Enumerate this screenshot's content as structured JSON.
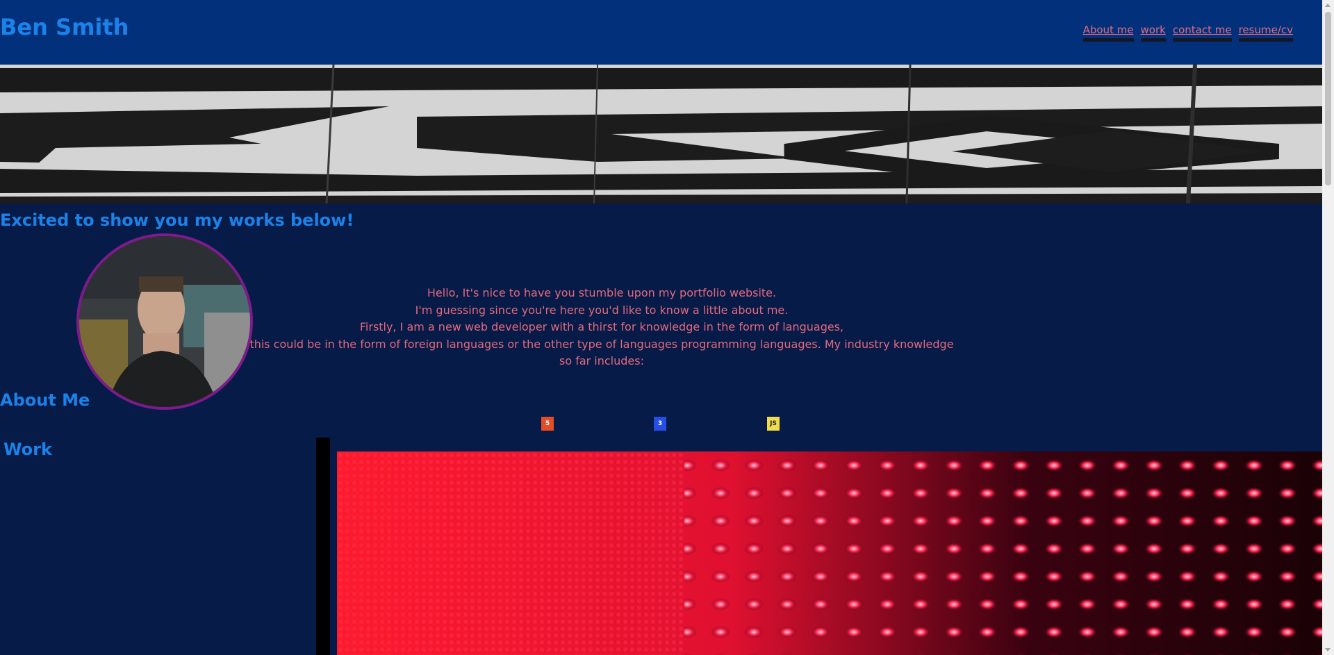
{
  "header": {
    "title": "Ben Smith",
    "nav": [
      {
        "label": "About me"
      },
      {
        "label": "work"
      },
      {
        "label": "contact me"
      },
      {
        "label": "resume/cv"
      }
    ]
  },
  "hero": {
    "tagline": "Excited to show you my works below!"
  },
  "about": {
    "heading": "About Me",
    "lines": [
      "Hello, It's nice to have you stumble upon my portfolio website.",
      "I'm guessing since you're here you'd like to know a little about me.",
      "Firstly, I am a new web developer with a thirst for knowledge in the form of languages,",
      "this could be in the form of foreign languages or the other type of languages programming languages. My industry knowledge so far includes:"
    ],
    "skills": [
      {
        "icon": "html5-icon",
        "glyph": "5",
        "color": "#e44d26"
      },
      {
        "icon": "css3-icon",
        "glyph": "3",
        "color": "#264de4"
      },
      {
        "icon": "javascript-icon",
        "glyph": "JS",
        "color": "#f0db4f"
      }
    ]
  },
  "work": {
    "heading": "Work"
  },
  "colors": {
    "header_bg": "#03307a",
    "page_bg": "#061b47",
    "heading": "#1b82ea",
    "body_text": "#e46a7e",
    "avatar_border": "#7d1a8c"
  }
}
